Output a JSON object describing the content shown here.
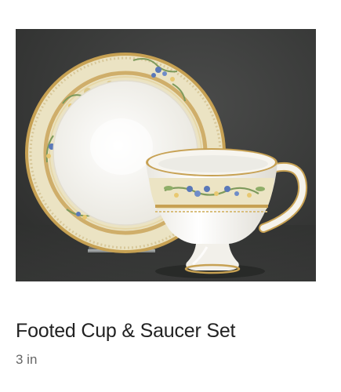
{
  "product": {
    "title": "Footed Cup & Saucer Set",
    "size": "3 in",
    "image_alt": "Footed cup and saucer set with gold-trimmed floral pattern"
  },
  "colors": {
    "backdrop": "#3a3b3a",
    "porcelain": "#f5f3ec",
    "cream_band": "#ece4c4",
    "gold_trim": "#c8a45a",
    "flower_blue": "#5a78b8",
    "leaf_green": "#7e9a5c"
  }
}
